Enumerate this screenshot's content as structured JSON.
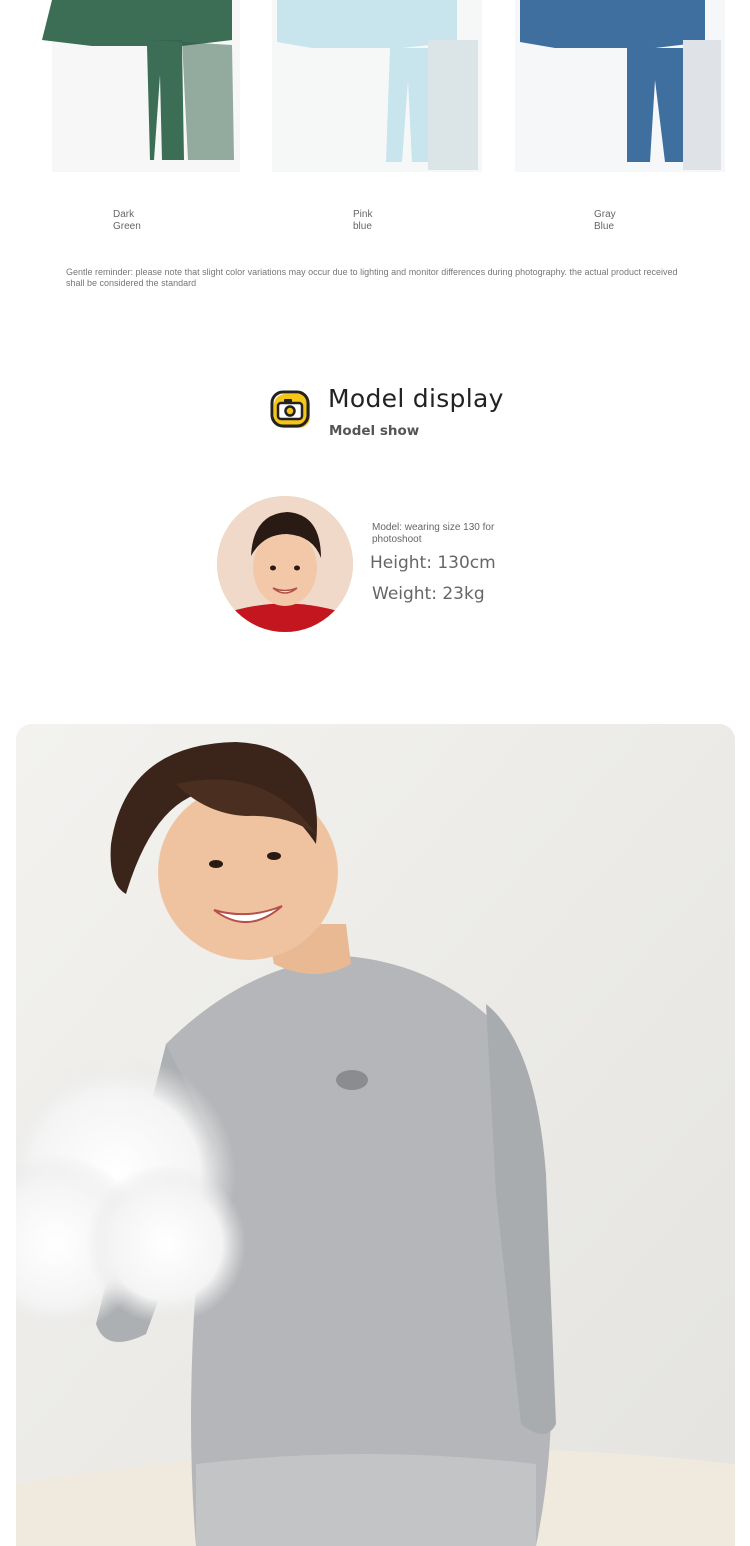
{
  "swatches": [
    {
      "label": "Dark\nGreen",
      "color": "#3b6e54"
    },
    {
      "label": "Pink\nblue",
      "color": "#c8e4ec"
    },
    {
      "label": "Gray\nBlue",
      "color": "#3f6f9e"
    }
  ],
  "reminder": "Gentle reminder: please note that slight color variations may occur due to lighting and monitor differences during photography. the actual product received shall be considered the standard",
  "model_section": {
    "title": "Model display",
    "subtitle": "Model show",
    "icon": "camera-icon",
    "note": "Model: wearing size 130 for photoshoot",
    "height": "Height: 130cm",
    "weight": "Weight: 23kg"
  },
  "colors": {
    "accent_yellow": "#f5c518",
    "shirt_gray": "#b4b6b9",
    "background": "#ffffff"
  }
}
